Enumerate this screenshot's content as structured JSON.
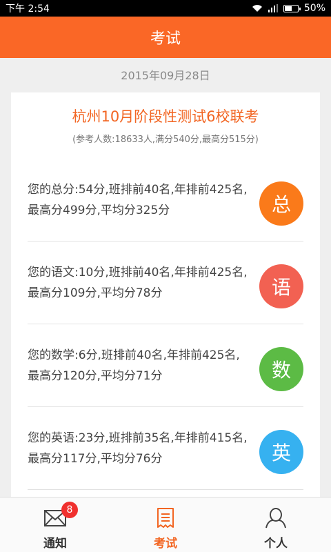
{
  "status_bar": {
    "time": "下午 2:54",
    "battery": "50%"
  },
  "header": {
    "title": "考试"
  },
  "exam": {
    "date": "2015年09月28日",
    "title": "杭州10月阶段性测试6校联考",
    "subtitle": "(参考人数:18633人,满分540分,最高分515分)"
  },
  "results": [
    {
      "text": "您的总分:54分,班排前40名,年排前425名,最高分499分,平均分325分",
      "badge": "总",
      "color": "#fa7a1a"
    },
    {
      "text": "您的语文:10分,班排前40名,年排前425名,最高分109分,平均分78分",
      "badge": "语",
      "color": "#f26152"
    },
    {
      "text": "您的数学:6分,班排前40名,年排前425名,最高分120分,平均分71分",
      "badge": "数",
      "color": "#5cbb45"
    },
    {
      "text": "您的英语:23分,班排前35名,年排前415名,最高分117分,平均分76分",
      "badge": "英",
      "color": "#36b1f0"
    }
  ],
  "tabs": [
    {
      "label": "通知",
      "badge": "8"
    },
    {
      "label": "考试"
    },
    {
      "label": "个人"
    }
  ]
}
